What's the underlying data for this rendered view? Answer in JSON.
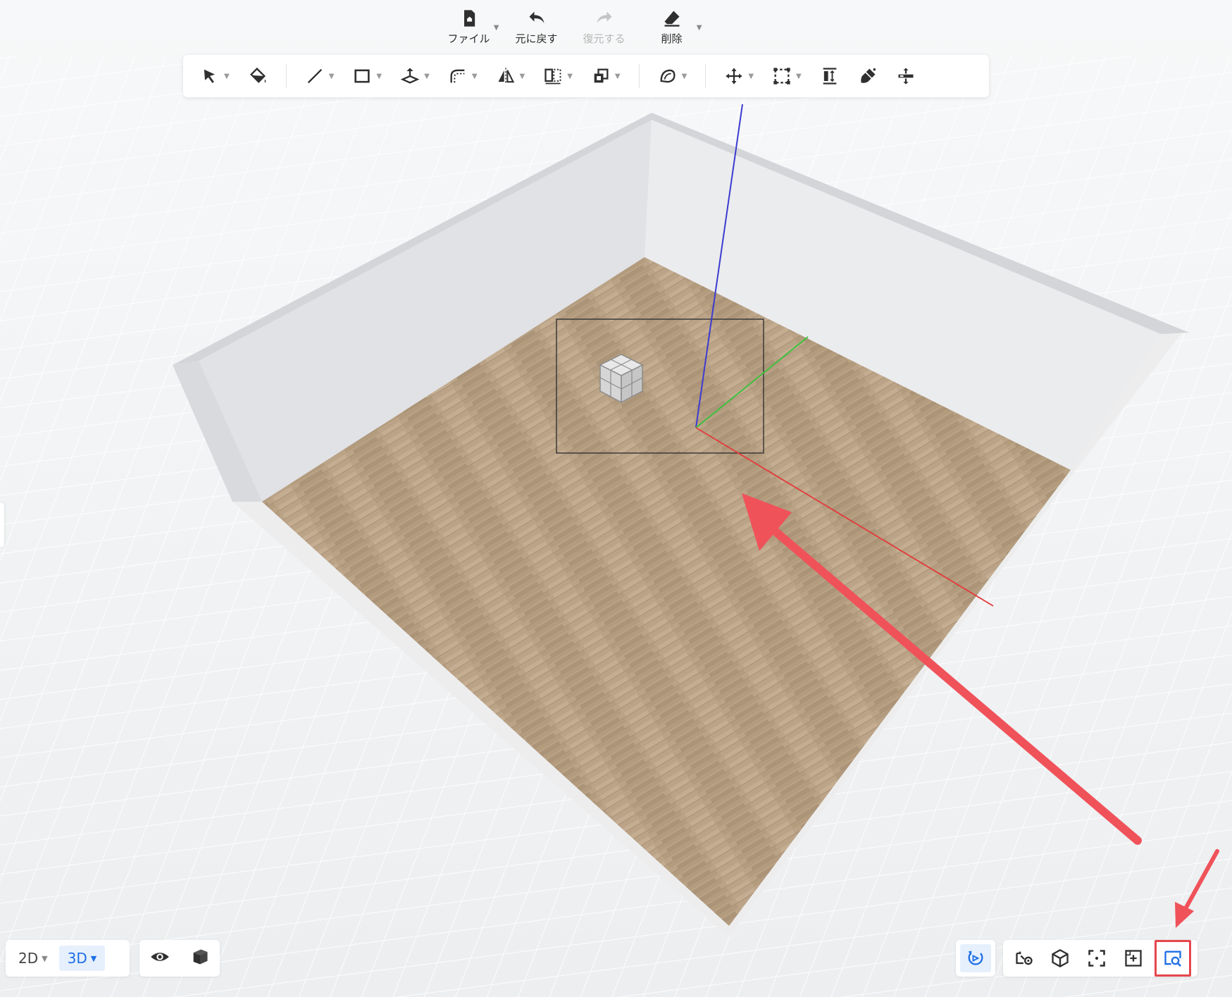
{
  "file_toolbar": {
    "items": [
      {
        "label": "ファイル",
        "icon": "file-home-icon",
        "has_menu": true,
        "enabled": true
      },
      {
        "label": "元に戻す",
        "icon": "undo-icon",
        "has_menu": false,
        "enabled": true
      },
      {
        "label": "復元する",
        "icon": "redo-icon",
        "has_menu": false,
        "enabled": false
      },
      {
        "label": "削除",
        "icon": "eraser-icon",
        "has_menu": true,
        "enabled": true
      }
    ]
  },
  "tool_toolbar": {
    "tools": [
      "select-arrow-icon",
      "paint-bucket-icon",
      "line-icon",
      "rectangle-icon",
      "push-pull-icon",
      "offset-curve-icon",
      "mirror-icon",
      "array-icon",
      "copy-icon",
      "sweep-icon",
      "move-icon",
      "group-select-icon",
      "align-icon",
      "brush-icon",
      "transform-icon"
    ]
  },
  "view_modes": {
    "modes": [
      {
        "label": "2D",
        "active": false
      },
      {
        "label": "3D",
        "active": true
      }
    ]
  },
  "view_tools": [
    "eye-icon",
    "solid-box-icon"
  ],
  "camera_tools": {
    "reset": "rotate-reset-icon",
    "items": [
      {
        "icon": "camera-settings-icon",
        "highlighted": false
      },
      {
        "icon": "cube-view-icon",
        "highlighted": false
      },
      {
        "icon": "fit-frame-icon",
        "highlighted": false
      },
      {
        "icon": "zoom-region-icon",
        "highlighted": false
      },
      {
        "icon": "zoom-search-icon",
        "highlighted": true
      }
    ]
  },
  "colors": {
    "accent": "#1f6fe6",
    "annotation": "#e5474d",
    "axis_x": "#e23b3b",
    "axis_y": "#3fbf3f",
    "axis_z": "#3b3bd1",
    "floor": "#b59d7f",
    "wall": "#e2e3e6"
  }
}
